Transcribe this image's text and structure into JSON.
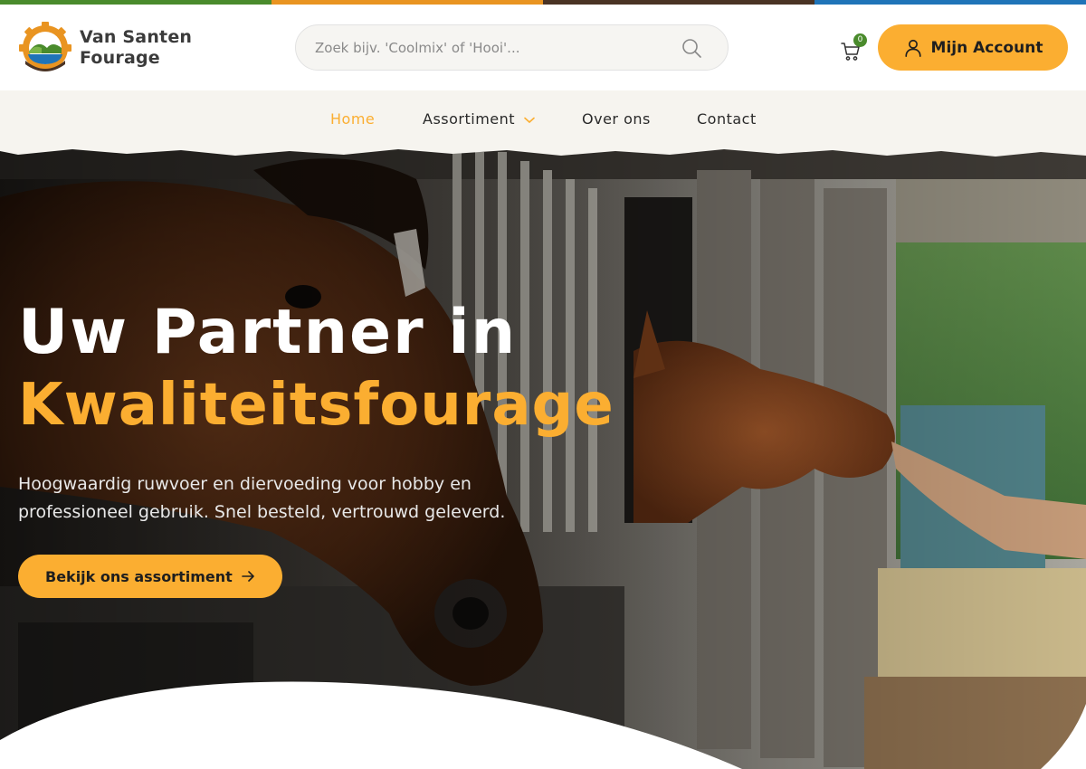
{
  "colors": {
    "strip": [
      "#4a8b2c",
      "#e99421",
      "#4a3324",
      "#1f74b8"
    ],
    "accent": "#fbae31",
    "nav_bg": "#f6f4ef",
    "badge": "#4a8b2c"
  },
  "header": {
    "logo_line1": "Van Santen",
    "logo_line2": "Fourage",
    "search_placeholder": "Zoek bijv. 'Coolmix' of 'Hooi'...",
    "cart_count": "0",
    "account_label": "Mijn Account"
  },
  "nav": {
    "items": [
      {
        "label": "Home",
        "active": true
      },
      {
        "label": "Assortiment",
        "has_dropdown": true
      },
      {
        "label": "Over ons"
      },
      {
        "label": "Contact"
      }
    ]
  },
  "hero": {
    "title_line1": "Uw Partner in",
    "title_line2": "Kwaliteitsfourage",
    "subtitle": "Hoogwaardig ruwvoer en diervoeding voor hobby en professioneel gebruik. Snel besteld, vertrouwd geleverd.",
    "cta_label": "Bekijk ons assortiment"
  },
  "icons": {
    "logo": "gear-landscape-logo-icon",
    "search": "search-icon",
    "cart": "cart-icon",
    "account": "user-icon",
    "dropdown": "chevron-down-icon",
    "cta": "arrow-right-icon"
  }
}
